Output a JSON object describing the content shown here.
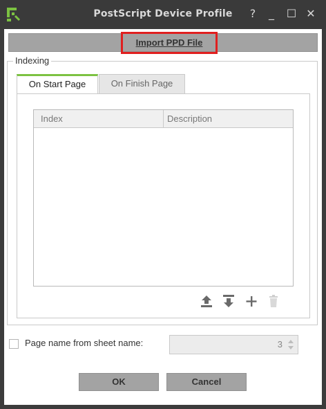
{
  "window": {
    "title": "PostScript Device Profile",
    "help_glyph": "?",
    "minimize_glyph": "_",
    "maximize_glyph": "☐",
    "close_glyph": "✕"
  },
  "toolbar": {
    "import_label": "Import PPD File"
  },
  "indexing": {
    "legend": "Indexing",
    "tabs": [
      {
        "label": "On Start Page",
        "active": true
      },
      {
        "label": "On Finish Page",
        "active": false
      }
    ],
    "table": {
      "columns": [
        "Index",
        "Description"
      ],
      "rows": []
    },
    "actions": [
      "upload-icon",
      "download-icon",
      "plus-icon",
      "trash-icon"
    ]
  },
  "page_name": {
    "label": "Page name from sheet name:",
    "checked": false,
    "value": "3"
  },
  "buttons": {
    "ok": "OK",
    "cancel": "Cancel"
  },
  "colors": {
    "titlebar": "#3a3a3a",
    "accent_green": "#7cc242",
    "highlight_red": "#e01f1f",
    "button_gray": "#a3a3a3"
  }
}
